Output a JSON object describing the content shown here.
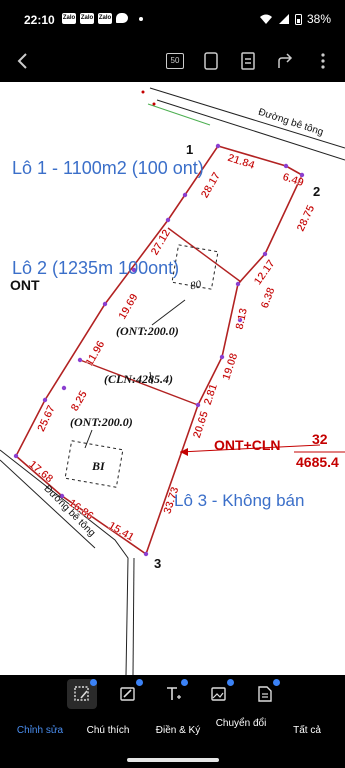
{
  "status": {
    "time": "22:10",
    "battery": "38%",
    "app_icons": [
      "Zalo",
      "Zalo",
      "Zalo"
    ]
  },
  "toolbar": {
    "page_label": "50"
  },
  "document": {
    "lot1": "Lô 1 - 1100m2 (100 ont)",
    "lot2": "Lô 2 (1235m 100ont)",
    "lot3": "Lô 3 - Không bán",
    "ont_left": "ONT",
    "road_top": "Đường bê tông",
    "road_bottom": "Đường bê tông",
    "corners": [
      "1",
      "2",
      "3"
    ],
    "ont_top": "(ONT:200.0)",
    "cln": "(CLN:4285.4)",
    "ont_bottom": "(ONT:200.0)",
    "bi": "BI",
    "eighty": "80",
    "callout_label": "ONT+CLN",
    "callout_num": "32",
    "callout_area": "4685.4",
    "dimensions": [
      "21.84",
      "6.49",
      "28.75",
      "12.17",
      "6.38",
      "28.17",
      "27.12",
      "19.69",
      "11.96",
      "8.25",
      "25.67",
      "17.68",
      "16.86",
      "15.41",
      "33.73",
      "20.65",
      "2.81",
      "19.08",
      "8.13"
    ]
  },
  "bottombar": {
    "tabs": [
      "Chỉnh sửa",
      "Chú thích",
      "Điền & Ký",
      "Chuyển đổi",
      "Tất cả"
    ],
    "active_tab": "Chỉnh sửa",
    "accent": "#4a8ef0"
  },
  "colors": {
    "boundary": "#b22222",
    "label_blue": "#3b6fc9",
    "vertex": "#8b3fd0",
    "dimension": "#c40000"
  }
}
